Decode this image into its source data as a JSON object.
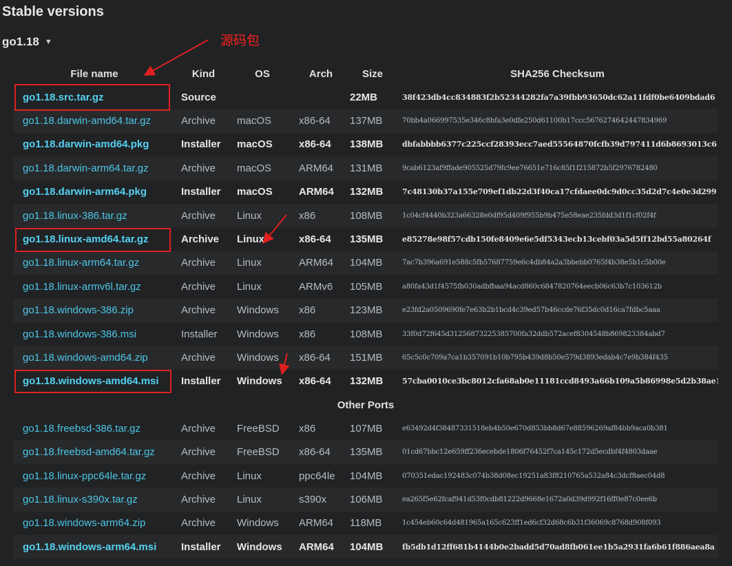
{
  "page": {
    "title": "Stable versions",
    "version_label": "go1.18",
    "annotation_text": "源码包"
  },
  "table": {
    "headers": {
      "name": "File name",
      "kind": "Kind",
      "os": "OS",
      "arch": "Arch",
      "size": "Size",
      "checksum": "SHA256 Checksum"
    },
    "rows": [
      {
        "name": "go1.18.src.tar.gz",
        "kind": "Source",
        "os": "",
        "arch": "",
        "size": "22MB",
        "sum": "38f423db4cc834883f2b52344282fa7a39fbb93650dc62a11fdf0be6409bdad6",
        "hl": true
      },
      {
        "name": "go1.18.darwin-amd64.tar.gz",
        "kind": "Archive",
        "os": "macOS",
        "arch": "x86-64",
        "size": "137MB",
        "sum": "70bb4a066997535e346c8bfa3e0dfe250d61100b17ccc5676274642447834969",
        "hl": false
      },
      {
        "name": "go1.18.darwin-amd64.pkg",
        "kind": "Installer",
        "os": "macOS",
        "arch": "x86-64",
        "size": "138MB",
        "sum": "dbfabbbb6377c225ccf28393ecc7aed55564870fcfb39d797411d6b8693013c6",
        "hl": true
      },
      {
        "name": "go1.18.darwin-arm64.tar.gz",
        "kind": "Archive",
        "os": "macOS",
        "arch": "ARM64",
        "size": "131MB",
        "sum": "9cab6123af9ffade905525d79fc9ee76651e716c85f1f215872b5f2976782480",
        "hl": false
      },
      {
        "name": "go1.18.darwin-arm64.pkg",
        "kind": "Installer",
        "os": "macOS",
        "arch": "ARM64",
        "size": "132MB",
        "sum": "7c48130b37a155e709ef1db22d3f40ca17cfdaee0dc9d0cc35d2d7c4e0e3d299",
        "hl": true
      },
      {
        "name": "go1.18.linux-386.tar.gz",
        "kind": "Archive",
        "os": "Linux",
        "arch": "x86",
        "size": "108MB",
        "sum": "1c04cf4440b323a66328e0df95d409f955b9b475e58eae235fdd3d1f1cf02f4f",
        "hl": false
      },
      {
        "name": "go1.18.linux-amd64.tar.gz",
        "kind": "Archive",
        "os": "Linux",
        "arch": "x86-64",
        "size": "135MB",
        "sum": "e85278e98f57cdb150fe8409e6e5df5343ecb13cebf03a5d5ff12bd55a80264f",
        "hl": true
      },
      {
        "name": "go1.18.linux-arm64.tar.gz",
        "kind": "Archive",
        "os": "Linux",
        "arch": "ARM64",
        "size": "104MB",
        "sum": "7ac7b396a691e588c5fb57687759e6c4db84a2a3bbebb0765f4b38e5b1c5b00e",
        "hl": false
      },
      {
        "name": "go1.18.linux-armv6l.tar.gz",
        "kind": "Archive",
        "os": "Linux",
        "arch": "ARMv6",
        "size": "105MB",
        "sum": "a80fa43d1f4575fb030adbfbaa94acd860c6847820764eecb06c63b7c103612b",
        "hl": false
      },
      {
        "name": "go1.18.windows-386.zip",
        "kind": "Archive",
        "os": "Windows",
        "arch": "x86",
        "size": "123MB",
        "sum": "e23fd2a0509690fe7e63b2b1bcd4c39ed57b46ccde76f35dc0d16ca7fdbc5aaa",
        "hl": false
      },
      {
        "name": "go1.18.windows-386.msi",
        "kind": "Installer",
        "os": "Windows",
        "arch": "x86",
        "size": "108MB",
        "sum": "33f0d72f645d31256873225385700fa32ddb572acef8304548b869823384abd7",
        "hl": false
      },
      {
        "name": "go1.18.windows-amd64.zip",
        "kind": "Archive",
        "os": "Windows",
        "arch": "x86-64",
        "size": "151MB",
        "sum": "65c5c0c709a7ca1b357091b10b795b439d8b50e579d3893edab4c7e9b384f435",
        "hl": false
      },
      {
        "name": "go1.18.windows-amd64.msi",
        "kind": "Installer",
        "os": "Windows",
        "arch": "x86-64",
        "size": "132MB",
        "sum": "57cba0010ce3bc8012cfa68ab0e11181ccd8493a66b109a5b86998e5d2b38ae1",
        "hl": true
      }
    ],
    "other_ports_label": "Other Ports",
    "other_rows": [
      {
        "name": "go1.18.freebsd-386.tar.gz",
        "kind": "Archive",
        "os": "FreeBSD",
        "arch": "x86",
        "size": "107MB",
        "sum": "e63492d4f38487331518eb4b50e670d853bb8d67e88596269af84bb9aca0b381",
        "hl": false
      },
      {
        "name": "go1.18.freebsd-amd64.tar.gz",
        "kind": "Archive",
        "os": "FreeBSD",
        "arch": "x86-64",
        "size": "135MB",
        "sum": "01cd67bbc12e659ff236ecebde1806f76452f7ca145c172d5ecdbf4f4803daae",
        "hl": false
      },
      {
        "name": "go1.18.linux-ppc64le.tar.gz",
        "kind": "Archive",
        "os": "Linux",
        "arch": "ppc64le",
        "size": "104MB",
        "sum": "070351edac192483c074b38d08ec19251a83f8210765a532a84c3dcf8aec04d8",
        "hl": false
      },
      {
        "name": "go1.18.linux-s390x.tar.gz",
        "kind": "Archive",
        "os": "Linux",
        "arch": "s390x",
        "size": "106MB",
        "sum": "ea265f5e62fcaf941d53f0cdb81222d9668e1672a0d39d992f16ff0e87c0ee6b",
        "hl": false
      },
      {
        "name": "go1.18.windows-arm64.zip",
        "kind": "Archive",
        "os": "Windows",
        "arch": "ARM64",
        "size": "118MB",
        "sum": "1c454eb60c64d481965a165c623ff1ed6cf32d68c6b31f36069c8768d908f093",
        "hl": false
      },
      {
        "name": "go1.18.windows-arm64.msi",
        "kind": "Installer",
        "os": "Windows",
        "arch": "ARM64",
        "size": "104MB",
        "sum": "fb5db1d12ff681b4144b0e2badd5d70ad8fb061ee1b5a2931fa6b61f886aea8a",
        "hl": true
      }
    ]
  },
  "colors": {
    "background": "#202224",
    "link": "#4fc6e6",
    "annotation": "#ff2020"
  }
}
